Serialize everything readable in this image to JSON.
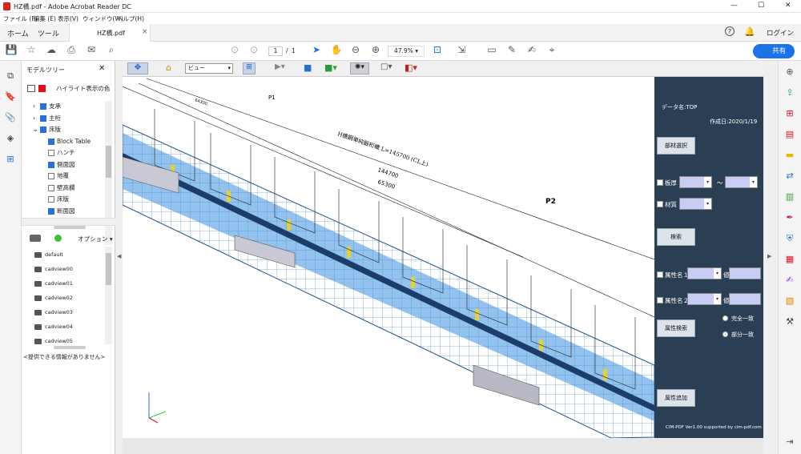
{
  "window": {
    "title": "HZ橋.pdf - Adobe Acrobat Reader DC",
    "min": "—",
    "max": "☐",
    "close": "✕"
  },
  "menu": [
    "ファイル (F)",
    "編集 (E)",
    "表示(V)",
    "ウィンドウ(W)",
    "ヘルプ(H)"
  ],
  "tabs": {
    "home": "ホーム",
    "tools": "ツール",
    "doc": "HZ橋.pdf",
    "close": "×",
    "login": "ログイン"
  },
  "toolbar": {
    "page_current": "1",
    "page_sep": "/",
    "page_total": "1",
    "zoom": "47.9%",
    "share": "共有"
  },
  "panel": {
    "title": "モデルツリー",
    "highlight_label": "ハイライト表示の色",
    "highlight_color": "#e01010",
    "tree": [
      {
        "label": "支承",
        "checked": true,
        "expand": true,
        "indent": 0
      },
      {
        "label": "主桁",
        "checked": true,
        "expand": true,
        "indent": 0
      },
      {
        "label": "床版",
        "checked": true,
        "expand": true,
        "open": true,
        "indent": 0
      },
      {
        "label": "Block Table",
        "checked": true,
        "indent": 1
      },
      {
        "label": "ハンチ",
        "checked": false,
        "indent": 1
      },
      {
        "label": "側面図",
        "checked": true,
        "indent": 1
      },
      {
        "label": "地覆",
        "checked": false,
        "indent": 1
      },
      {
        "label": "壁高欄",
        "checked": false,
        "indent": 1
      },
      {
        "label": "床版",
        "checked": false,
        "indent": 1
      },
      {
        "label": "断面図",
        "checked": true,
        "indent": 1
      }
    ],
    "options_label": "オプション",
    "views": [
      "default",
      "cadview00",
      "cadview01",
      "cadview02",
      "cadview03",
      "cadview04",
      "cadview05"
    ],
    "info": "<提供できる情報がありません>"
  },
  "view3d": {
    "view_select": "ビュー"
  },
  "drawing": {
    "p1": "P1",
    "p2": "P2",
    "bridge_name": "H橋鋼単純鈑桁橋  L=145700 (CL上)",
    "dim1": "144700",
    "dim2": "65300",
    "dim3": "64300"
  },
  "form": {
    "data_name": "データ名:TOP",
    "created": "作成日:2020/1/19",
    "member_select": "部材選択",
    "plate": "板厚",
    "tilde": "～",
    "material": "材質",
    "search": "検索",
    "attr1": "属性名１",
    "attr2": "属性名２",
    "value": "値",
    "attr_search": "属性検索",
    "exact": "完全一致",
    "partial": "部分一致",
    "attr_add": "属性追加",
    "footer": "CIM-PDF Ver1.00 supported by cim-pdf.com"
  },
  "colors": {
    "accent": "#1a73e8",
    "form_bg": "#2b3f54",
    "girder": "#3b8fe0",
    "highlight": "#e0d23a"
  }
}
